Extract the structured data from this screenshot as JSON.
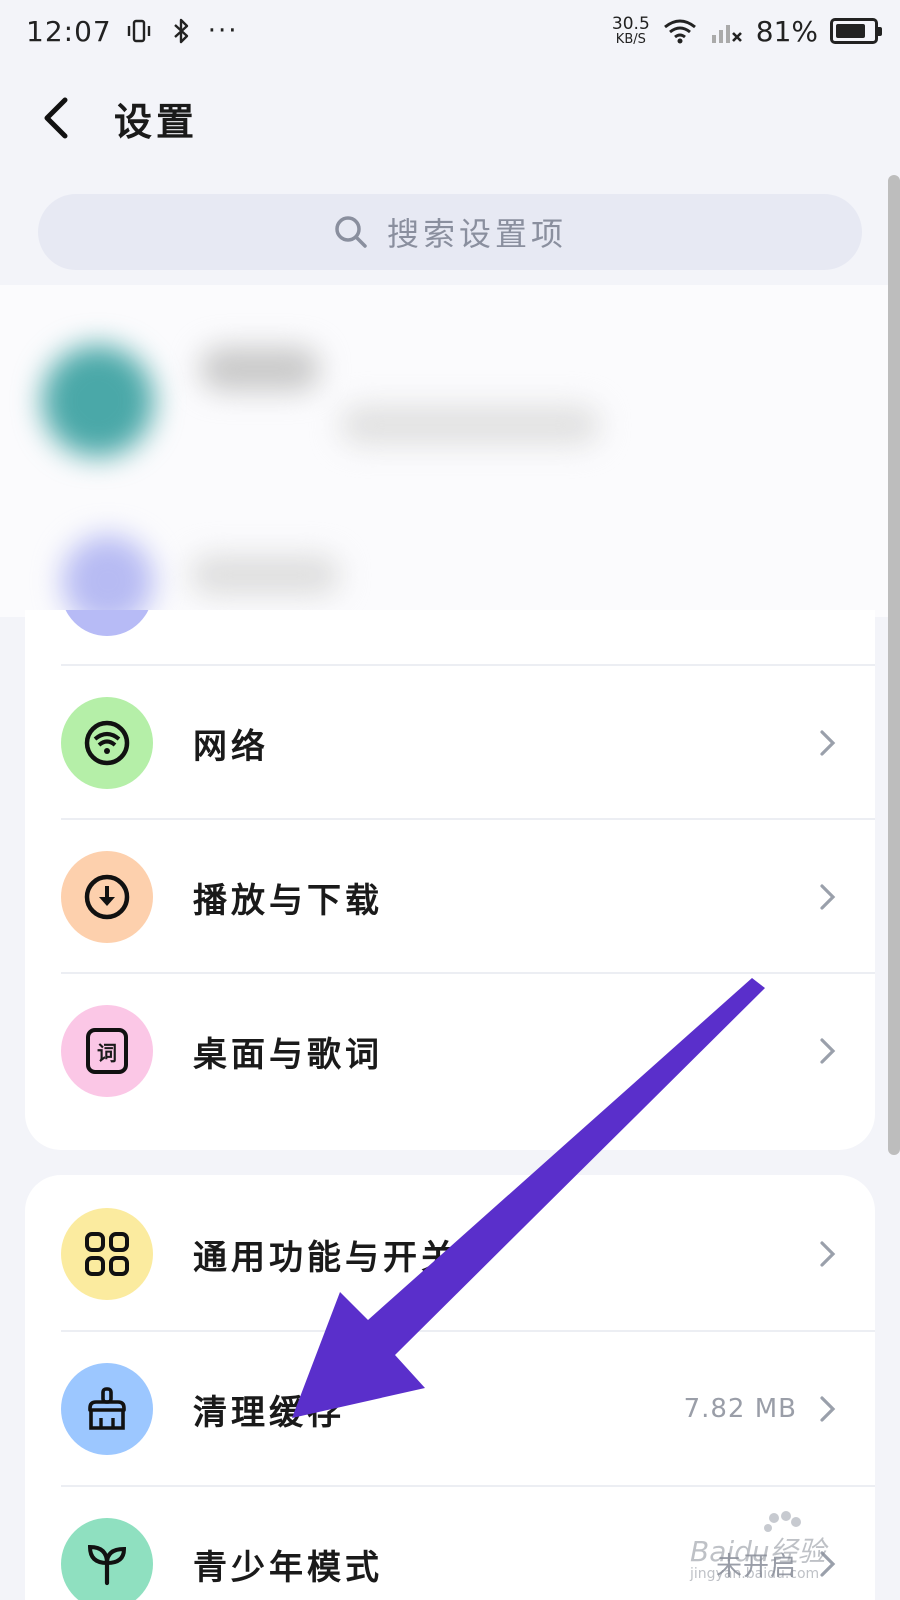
{
  "status_bar": {
    "time": "12:07",
    "more": "···",
    "net_speed_value": "30.5",
    "net_speed_unit": "KB/S",
    "battery_percent": "81%",
    "battery_level": 0.81
  },
  "header": {
    "title": "设置"
  },
  "search": {
    "placeholder": "搜索设置项"
  },
  "card1_items": [
    {
      "label": "网络",
      "icon": "wifi-icon",
      "icon_bg": "#b5efa8"
    },
    {
      "label": "播放与下载",
      "icon": "download-icon",
      "icon_bg": "#fdd0ad"
    },
    {
      "label": "桌面与歌词",
      "icon": "lyrics-icon",
      "icon_glyph": "词",
      "icon_bg": "#fbc7e6"
    }
  ],
  "card2_items": [
    {
      "label": "通用功能与开关",
      "icon": "grid-icon",
      "icon_bg": "#fbeb9f"
    },
    {
      "label": "清理缓存",
      "value": "7.82 MB",
      "icon": "broom-icon",
      "icon_bg": "#9cc7ff"
    },
    {
      "label": "青少年模式",
      "value": "未开启",
      "icon": "sprout-icon",
      "icon_bg": "#8fe0c0"
    }
  ],
  "colors": {
    "arrow": "#5a2fcb",
    "background": "#f3f4f9",
    "card": "#ffffff"
  },
  "watermark": {
    "brand": "Baidu经验",
    "url": "jingyan.baidu.com"
  }
}
